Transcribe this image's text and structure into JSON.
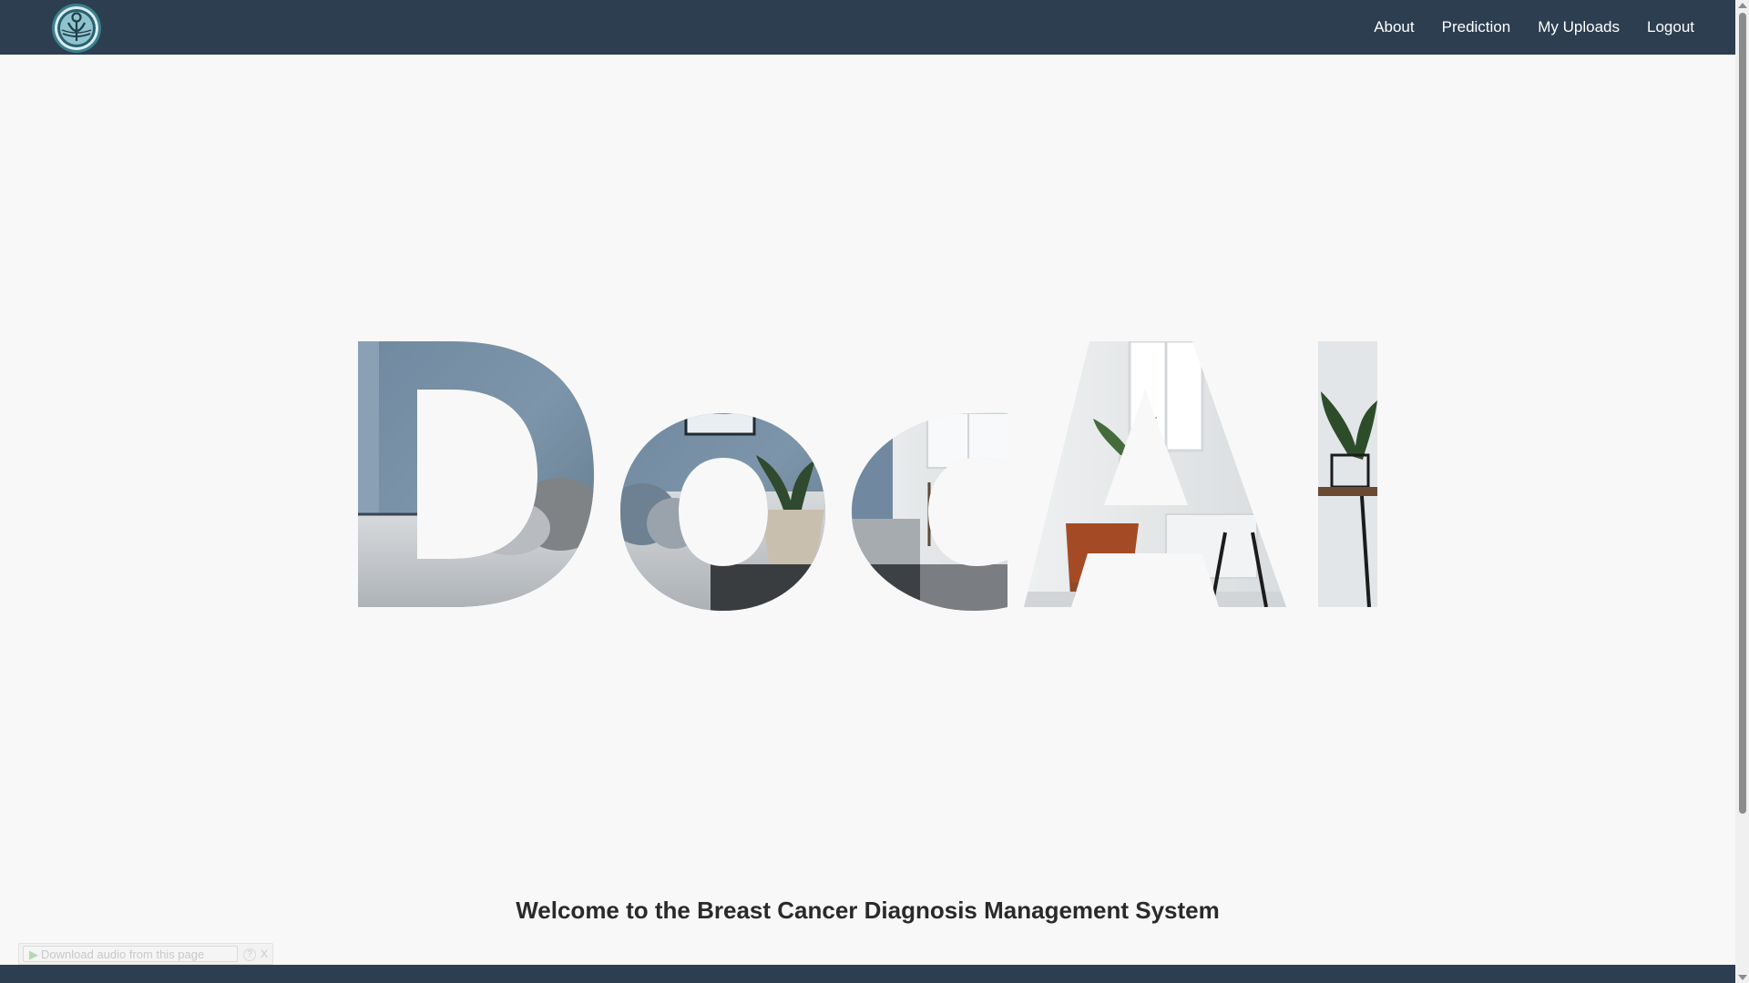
{
  "nav": {
    "items": [
      {
        "label": "About"
      },
      {
        "label": "Prediction"
      },
      {
        "label": "My Uploads"
      },
      {
        "label": "Logout"
      }
    ],
    "logo_icon": "ribbon-logo-icon"
  },
  "hero": {
    "word": "DocAI"
  },
  "welcome": {
    "text": "Welcome to the Breast Cancer Diagnosis Management System"
  },
  "audio_bar": {
    "label": "Download audio from this page",
    "help": "?",
    "close": "X"
  },
  "colors": {
    "navbar": "#2c3e50",
    "background": "#f8f8f8",
    "text": "#2a2a2a"
  }
}
